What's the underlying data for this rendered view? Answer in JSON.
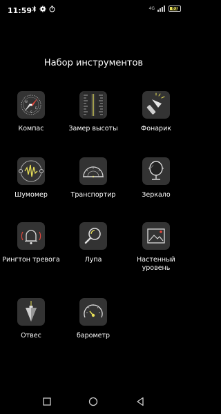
{
  "status": {
    "time": "11:59",
    "network_label": "4G",
    "battery_level": "81",
    "battery_fraction": 0.81
  },
  "page": {
    "title": "Набор инструментов"
  },
  "tools": [
    {
      "label": "Компас",
      "icon": "compass-icon"
    },
    {
      "label": "Замер высоты",
      "icon": "ruler-icon"
    },
    {
      "label": "Фонарик",
      "icon": "flashlight-icon"
    },
    {
      "label": "Шумомер",
      "icon": "sound-meter-icon"
    },
    {
      "label": "Транспортир",
      "icon": "protractor-icon"
    },
    {
      "label": "Зеркало",
      "icon": "mirror-icon"
    },
    {
      "label": "Рингтон тревога",
      "icon": "alarm-bell-icon"
    },
    {
      "label": "Лупа",
      "icon": "magnifier-icon"
    },
    {
      "label": "Настенный уровень",
      "icon": "wall-level-icon"
    },
    {
      "label": "Отвес",
      "icon": "plumb-bob-icon"
    },
    {
      "label": "барометр",
      "icon": "barometer-icon"
    }
  ],
  "colors": {
    "background": "#000000",
    "tile": "#333333",
    "accent_red": "#e2463c",
    "accent_yellow": "#e8e058"
  }
}
